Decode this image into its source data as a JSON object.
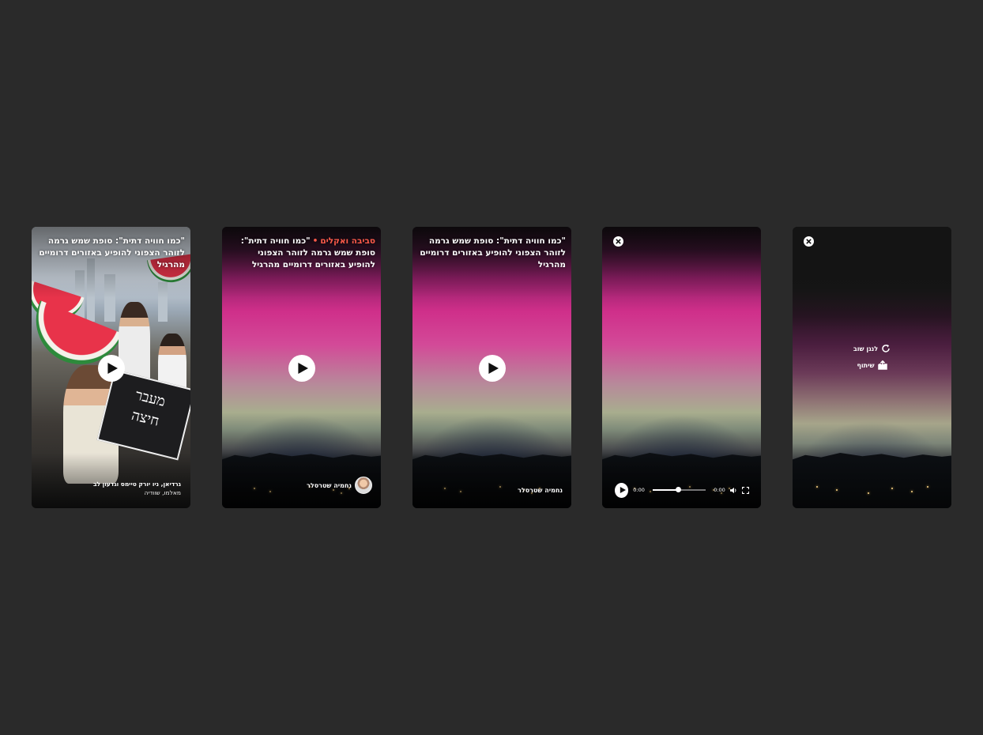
{
  "cards": [
    {
      "type": "photo",
      "headline": "\"כמו חוויה דתית\": סופת שמש גרמה לזוהר הצפוני להופיע באזורים דרומיים מהרגיל",
      "credit_line1": "גרדיאן, ניו יורק טיימס וגדעון לב",
      "credit_line2": "מאלמו, שוודיה",
      "sign_text": "מעבר\nחיצה"
    },
    {
      "type": "aurora",
      "section": "סביבה ואקלים",
      "separator": "•",
      "headline": "\"כמו חוויה דתית\": סופת שמש גרמה לזוהר הצפוני להופיע באזורים דרומיים מהרגיל",
      "author": "נחמיה שטרסלר"
    },
    {
      "type": "aurora",
      "headline": "\"כמו חוויה דתית\": סופת שמש גרמה לזוהר הצפוני להופיע באזורים דרומיים מהרגיל",
      "author": "נחמיה שטרסלר"
    },
    {
      "type": "player",
      "current_time": "0:00",
      "duration": "0:00",
      "progress_fraction": 0.47
    },
    {
      "type": "end",
      "replay_label": "לנגן שוב",
      "share_label": "שיתוף"
    }
  ],
  "icons": {
    "play": "play-icon",
    "close": "close-icon",
    "volume": "volume-icon",
    "fullscreen": "fullscreen-icon",
    "replay": "replay-icon",
    "share": "share-icon"
  },
  "colors": {
    "page_bg": "#2a2a2a",
    "section_accent": "#ff5b4a",
    "aurora_pink": "#cf2f8a"
  }
}
